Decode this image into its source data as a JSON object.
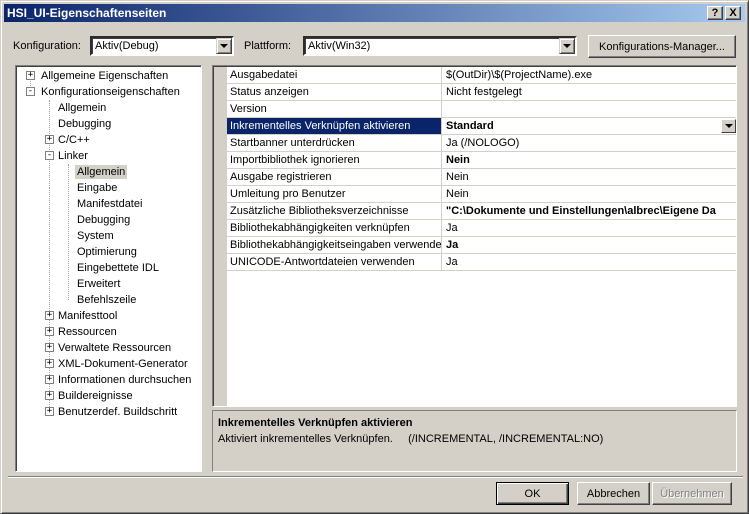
{
  "window": {
    "title": "HSI_UI-Eigenschaftenseiten",
    "help_glyph": "?",
    "close_glyph": "X"
  },
  "toolbar": {
    "config_label": "Konfiguration:",
    "config_value": "Aktiv(Debug)",
    "platform_label": "Plattform:",
    "platform_value": "Aktiv(Win32)",
    "manager_button": "Konfigurations-Manager..."
  },
  "tree": {
    "nodes": [
      {
        "label": "Allgemeine Eigenschaften",
        "expander": "+"
      },
      {
        "label": "Konfigurationseigenschaften",
        "expander": "-"
      },
      {
        "label": "Allgemein"
      },
      {
        "label": "Debugging"
      },
      {
        "label": "C/C++",
        "expander": "+"
      },
      {
        "label": "Linker",
        "expander": "-"
      },
      {
        "label": "Allgemein",
        "selected": true
      },
      {
        "label": "Eingabe"
      },
      {
        "label": "Manifestdatei"
      },
      {
        "label": "Debugging"
      },
      {
        "label": "System"
      },
      {
        "label": "Optimierung"
      },
      {
        "label": "Eingebettete IDL"
      },
      {
        "label": "Erweitert"
      },
      {
        "label": "Befehlszeile"
      },
      {
        "label": "Manifesttool",
        "expander": "+"
      },
      {
        "label": "Ressourcen",
        "expander": "+"
      },
      {
        "label": "Verwaltete Ressourcen",
        "expander": "+"
      },
      {
        "label": "XML-Dokument-Generator",
        "expander": "+"
      },
      {
        "label": "Informationen durchsuchen",
        "expander": "+"
      },
      {
        "label": "Buildereignisse",
        "expander": "+"
      },
      {
        "label": "Benutzerdef. Buildschritt",
        "expander": "+"
      }
    ]
  },
  "properties": [
    {
      "name": "Ausgabedatei",
      "value": "$(OutDir)\\$(ProjectName).exe",
      "bold": false
    },
    {
      "name": "Status anzeigen",
      "value": "Nicht festgelegt",
      "bold": false
    },
    {
      "name": "Version",
      "value": "",
      "bold": false
    },
    {
      "name": "Inkrementelles Verknüpfen aktivieren",
      "value": "Standard",
      "bold": true,
      "selected": true
    },
    {
      "name": "Startbanner unterdrücken",
      "value": "Ja (/NOLOGO)",
      "bold": false
    },
    {
      "name": "Importbibliothek ignorieren",
      "value": "Nein",
      "bold": true
    },
    {
      "name": "Ausgabe registrieren",
      "value": "Nein",
      "bold": false
    },
    {
      "name": "Umleitung pro Benutzer",
      "value": "Nein",
      "bold": false
    },
    {
      "name": "Zusätzliche Bibliotheksverzeichnisse",
      "value": "\"C:\\Dokumente und Einstellungen\\albrec\\Eigene Da",
      "bold": true
    },
    {
      "name": "Bibliothekabhängigkeiten verknüpfen",
      "value": "Ja",
      "bold": false
    },
    {
      "name": "Bibliothekabhängigkeitseingaben verwenden",
      "value": "Ja",
      "bold": true
    },
    {
      "name": "UNICODE-Antwortdateien verwenden",
      "value": "Ja",
      "bold": false
    }
  ],
  "description": {
    "title": "Inkrementelles Verknüpfen aktivieren",
    "text": "Aktiviert inkrementelles Verknüpfen.     (/INCREMENTAL, /INCREMENTAL:NO)"
  },
  "buttons": {
    "ok": "OK",
    "cancel": "Abbrechen",
    "apply": "Übernehmen"
  },
  "colors": {
    "title_start": "#0a246a",
    "title_end": "#a6caf0",
    "selection": "#0a246a",
    "face": "#d4d0c8"
  }
}
